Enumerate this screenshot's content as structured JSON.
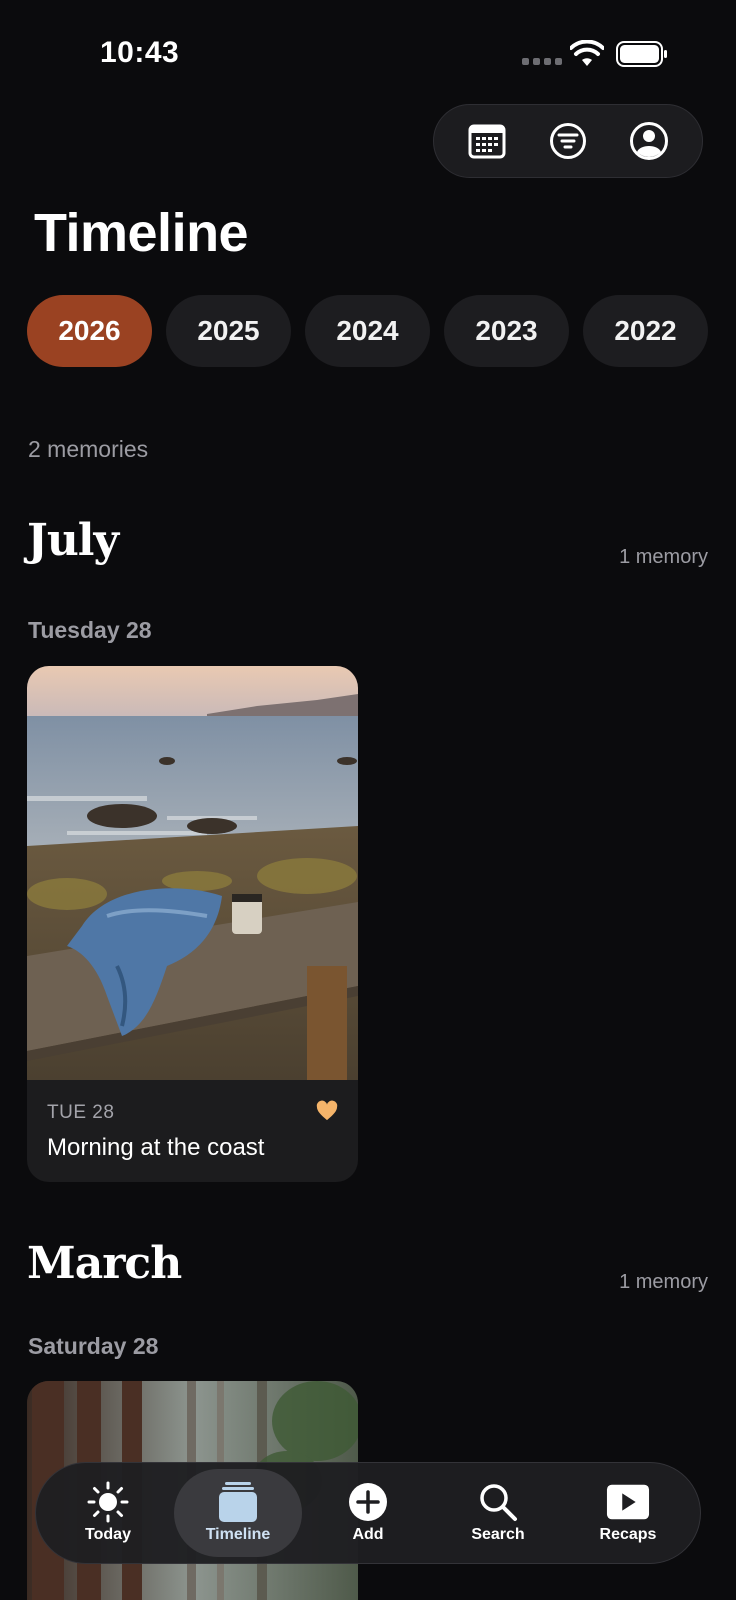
{
  "status_bar": {
    "time": "10:43"
  },
  "header": {
    "title": "Timeline"
  },
  "top_actions": [
    {
      "name": "calendar-icon"
    },
    {
      "name": "filter-icon"
    },
    {
      "name": "profile-icon"
    }
  ],
  "years": [
    {
      "label": "2026",
      "selected": true
    },
    {
      "label": "2025",
      "selected": false
    },
    {
      "label": "2024",
      "selected": false
    },
    {
      "label": "2023",
      "selected": false
    },
    {
      "label": "2022",
      "selected": false
    }
  ],
  "summary": {
    "count_text": "2 memories"
  },
  "sections": [
    {
      "month": "July",
      "count_text": "1 memory",
      "day": "Tuesday 28",
      "card": {
        "date": "TUE 28",
        "title": "Morning at the coast",
        "favorited": true,
        "heart_color": "#f5b46a"
      }
    },
    {
      "month": "March",
      "count_text": "1 memory",
      "day": "Saturday 28"
    }
  ],
  "tab_bar": {
    "tabs": [
      {
        "label": "Today",
        "icon": "sun-icon",
        "active": false
      },
      {
        "label": "Timeline",
        "icon": "timeline-stack-icon",
        "active": true
      },
      {
        "label": "Add",
        "icon": "add-circle-icon",
        "active": false
      },
      {
        "label": "Search",
        "icon": "search-icon",
        "active": false
      },
      {
        "label": "Recaps",
        "icon": "play-icon",
        "active": false
      }
    ]
  },
  "colors": {
    "accent": "#9a4222",
    "background": "#0b0b0d",
    "pill": "#1d1d20"
  }
}
